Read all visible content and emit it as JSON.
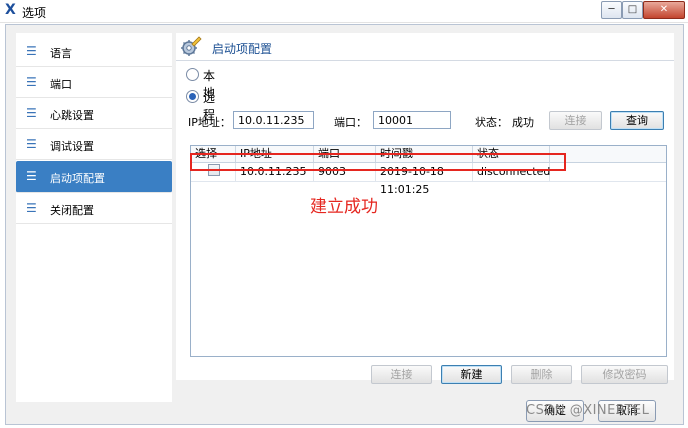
{
  "window": {
    "title": "选项",
    "logo_glyph": "X",
    "controls": {
      "minimize": "─",
      "maximize": "□",
      "close": "✕"
    }
  },
  "sidebar": {
    "icon_glyph": "☰",
    "items": [
      {
        "label": "语言",
        "active": false
      },
      {
        "label": "端口",
        "active": false
      },
      {
        "label": "心跳设置",
        "active": false
      },
      {
        "label": "调试设置",
        "active": false
      },
      {
        "label": "启动项配置",
        "active": true
      },
      {
        "label": "关闭配置",
        "active": false
      }
    ]
  },
  "panel": {
    "title": "启动项配置",
    "mode_options": [
      {
        "label": "本地",
        "checked": false
      },
      {
        "label": "远程",
        "checked": true
      }
    ],
    "ip_label": "IP地址：",
    "ip_value": "10.0.11.235",
    "port_label": "端口：",
    "port_value": "10001",
    "status_label": "状态：",
    "status_value": "成功",
    "connect_label": "连接",
    "query_label": "查询",
    "table": {
      "headers": [
        "选择",
        "IP地址",
        "端口",
        "时间戳",
        "状态"
      ],
      "rows": [
        {
          "selected": false,
          "ip": "10.0.11.235",
          "port": "9003",
          "timestamp": "2019-10-18 11:01:25",
          "status": "disconnected"
        }
      ]
    },
    "actions": {
      "connect": "连接",
      "new": "新建",
      "delete": "删除",
      "change_password": "修改密码"
    }
  },
  "annotation": {
    "text": "建立成功",
    "color": "#e5261f"
  },
  "dialog": {
    "ok": "确定",
    "cancel": "取消"
  },
  "watermark": "CSDN @XINERTEL",
  "colors": {
    "accent": "#3a7fc4",
    "panel_title": "#1b4f92",
    "highlight": "#e5261f"
  }
}
